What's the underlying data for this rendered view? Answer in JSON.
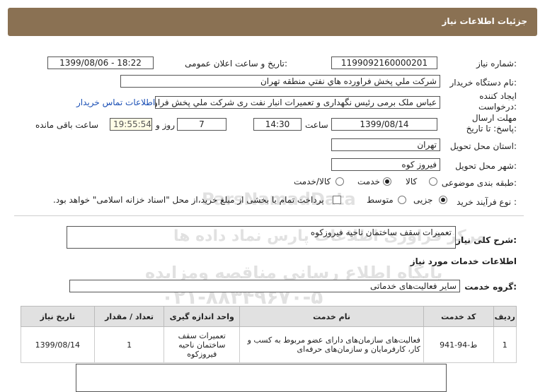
{
  "header": {
    "title": "جزئیات اطلاعات نیاز"
  },
  "form": {
    "need_number_label": "شماره نیاز:",
    "need_number": "1199092160000201",
    "announce_label": "تاریخ و ساعت اعلان عمومی:",
    "announce_value": "1399/08/06 - 18:22",
    "buyer_label": "نام دستگاه خریدار:",
    "buyer_value": "شرکت ملي پخش فراورده هاي نفتي منطقه تهران",
    "creator_label": "ایجاد کننده درخواست:",
    "creator_value": "عباس ملک برمی رئیس نگهداری و تعمیرات انبار نفت ری شرکت ملي پخش فراورد",
    "contact_link": "اطلاعات تماس خریدار",
    "deadline_label": "مهلت ارسال پاسخ: تا تاریخ:",
    "deadline_date": "1399/08/14",
    "time_label": "ساعت",
    "deadline_time": "14:30",
    "days_value": "7",
    "days_label": "روز و",
    "remaining_value": "19:55:54",
    "remaining_label": "ساعت باقی مانده",
    "province_label": "استان محل تحویل:",
    "province_value": "تهران",
    "city_label": "شهر محل تحویل:",
    "city_value": "فیروز کوه",
    "category_label": "طبقه بندی موضوعی:",
    "category_options": [
      "کالا",
      "خدمت",
      "کالا/خدمت"
    ],
    "category_selected": "خدمت",
    "process_label": "نوع فرآیند خرید :",
    "process_options": [
      "جزیی",
      "متوسط"
    ],
    "process_selected": "جزیی",
    "payment_text": "پرداخت تمام یا بخشی از مبلغ خرید،از محل \"اسناد خزانه اسلامی\" خواهد بود."
  },
  "description": {
    "label": "شرح کلی نیاز:",
    "value": "تعمیرات سقف ساختمان  ناحیه فیروزکوه"
  },
  "services": {
    "section_title": "اطلاعات خدمات مورد نیاز",
    "group_label": "گروه خدمت:",
    "group_value": "سایر فعالیت‌های خدماتی",
    "columns": [
      "ردیف",
      "کد خدمت",
      "نام خدمت",
      "واحد اندازه گیری",
      "تعداد / مقدار",
      "تاریخ نیاز"
    ],
    "rows": [
      {
        "index": "1",
        "code": "ط-94-941",
        "name": "فعالیت‌های سازمان‌های دارای عضو مربوط به کسب و کار، کارفرمایان و سازمان‌های حرفه‌ای",
        "unit": "تعمیرات سقف ساختمان ناحیه فیروزکوه",
        "qty": "1",
        "date": "1399/08/14"
      }
    ]
  },
  "watermark": {
    "brand": "ParsNamadData",
    "line1": "مرکز فراوری اطلاعات پارس نماد داده ها",
    "line2": "پایگاه اطلاع رسانی مناقصه ومزایده",
    "phone": "۰۲۱-۸۸۳۴۹۶۷۰-۵"
  },
  "colors": {
    "header_bg": "#8a7153",
    "link": "#1a4fb5",
    "remaining_bg": "#fffde6"
  }
}
